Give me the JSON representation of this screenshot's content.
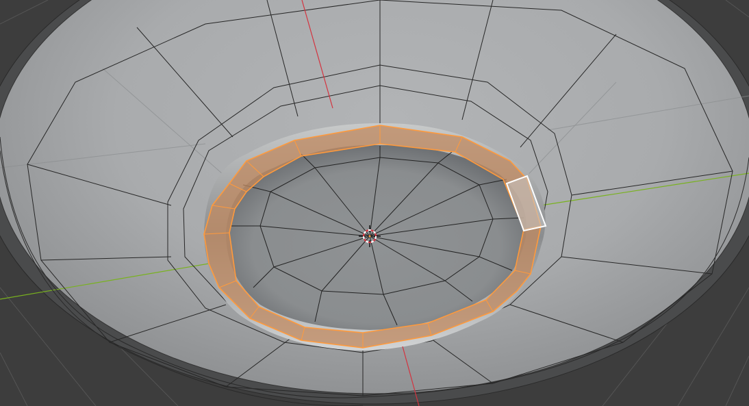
{
  "viewport": {
    "mode": "edit-mode",
    "background_color": "#3d3d3d",
    "object_color": "#a9acae",
    "wire_color": "#222222",
    "selected_color": "#ff9a3c",
    "active_face_color": "#ffffff",
    "axis_x_color": "#d4333f",
    "axis_y_color": "#79b21e",
    "grid_color": "#555555",
    "cursor_icon": "3d-cursor-icon"
  }
}
